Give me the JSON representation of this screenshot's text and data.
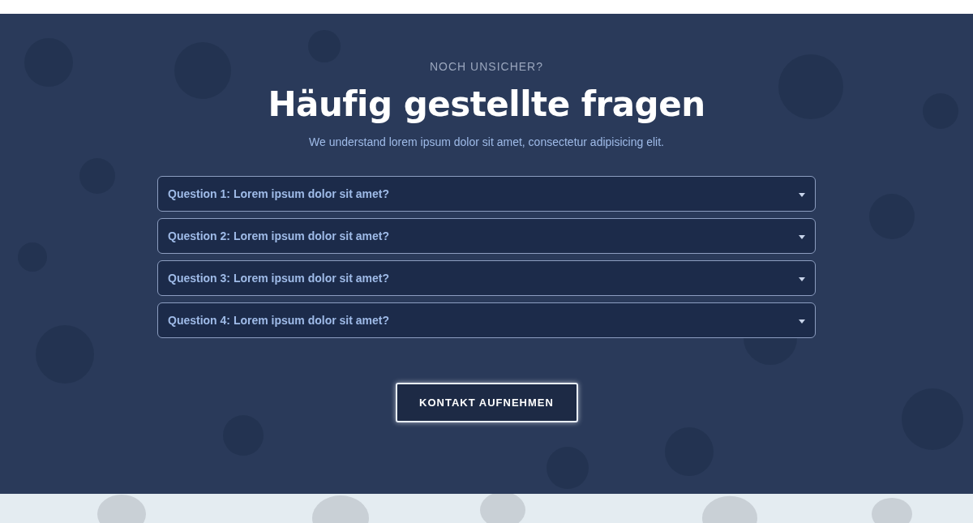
{
  "section": {
    "eyebrow": "NOCH UNSICHER?",
    "title": "Häufig gestellte fragen",
    "subtitle": "We understand lorem ipsum dolor sit amet, consectetur adipisicing elit."
  },
  "faq": [
    {
      "question": "Question 1: Lorem ipsum dolor sit amet?",
      "expanded": false
    },
    {
      "question": "Question 2: Lorem ipsum dolor sit amet?",
      "expanded": false
    },
    {
      "question": "Question 3: Lorem ipsum dolor sit amet?",
      "expanded": false
    },
    {
      "question": "Question 4: Lorem ipsum dolor sit amet?",
      "expanded": false
    }
  ],
  "contact_button": "KONTAKT AUFNEHMEN"
}
